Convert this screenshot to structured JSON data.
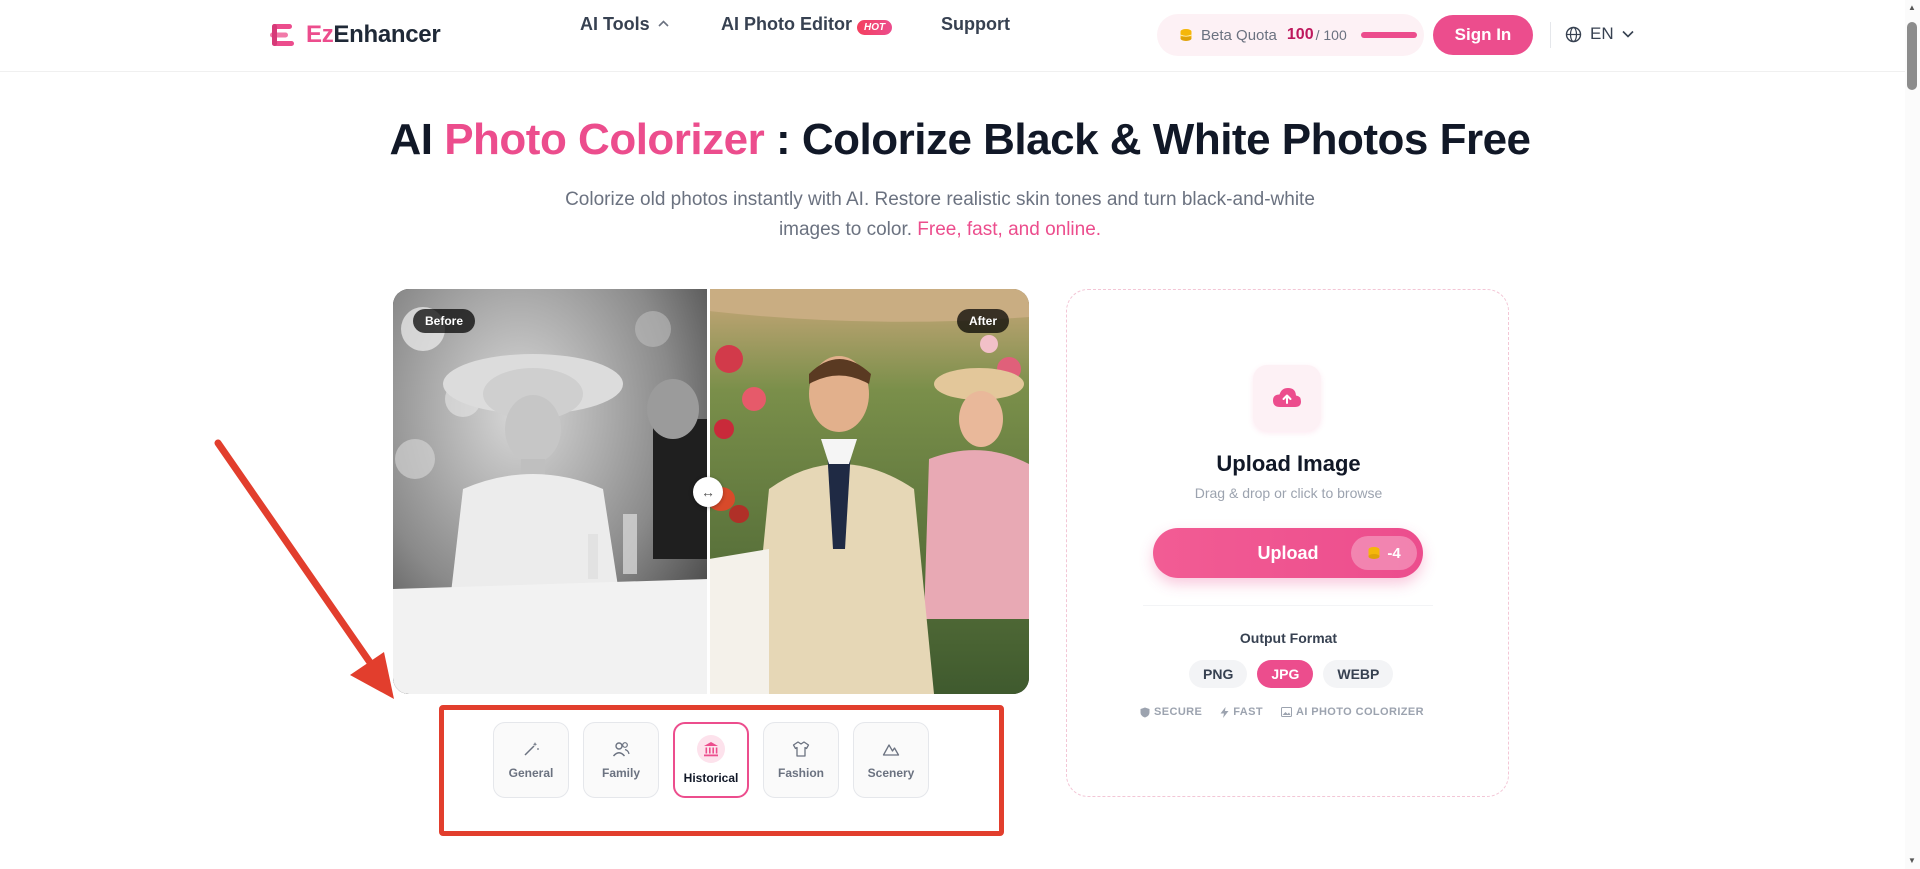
{
  "header": {
    "logo_ez": "Ez",
    "logo_rest": "Enhancer",
    "nav": {
      "ai_tools": "AI Tools",
      "photo_editor": "AI Photo Editor",
      "hot_badge": "HOT",
      "support": "Support"
    },
    "quota": {
      "label": "Beta Quota",
      "used": "100",
      "total": "/ 100"
    },
    "signin": "Sign In",
    "language": "EN"
  },
  "hero": {
    "title_prefix": "AI ",
    "title_accent": "Photo Colorizer",
    "title_suffix": " : Colorize Black & White Photos Free",
    "subtitle": "Colorize old photos instantly with AI. Restore realistic skin tones and turn black-and-white images to color. ",
    "subtitle_accent": "Free, fast, and online."
  },
  "compare": {
    "before_label": "Before",
    "after_label": "After"
  },
  "styles": [
    {
      "label": "General",
      "icon": "magic-wand-icon",
      "active": false
    },
    {
      "label": "Family",
      "icon": "users-icon",
      "active": false
    },
    {
      "label": "Historical",
      "icon": "landmark-icon",
      "active": true
    },
    {
      "label": "Fashion",
      "icon": "shirt-icon",
      "active": false
    },
    {
      "label": "Scenery",
      "icon": "mountain-icon",
      "active": false
    }
  ],
  "upload": {
    "title": "Upload Image",
    "subtitle": "Drag & drop or click to browse",
    "button_label": "Upload",
    "cost": "-4",
    "format_title": "Output Format",
    "formats": [
      {
        "label": "PNG",
        "active": false
      },
      {
        "label": "JPG",
        "active": true
      },
      {
        "label": "WEBP",
        "active": false
      }
    ],
    "badges": [
      "SECURE",
      "FAST",
      "AI PHOTO COLORIZER"
    ]
  },
  "colors": {
    "brand": "#ec4d8d",
    "annotation": "#e23e2d"
  }
}
